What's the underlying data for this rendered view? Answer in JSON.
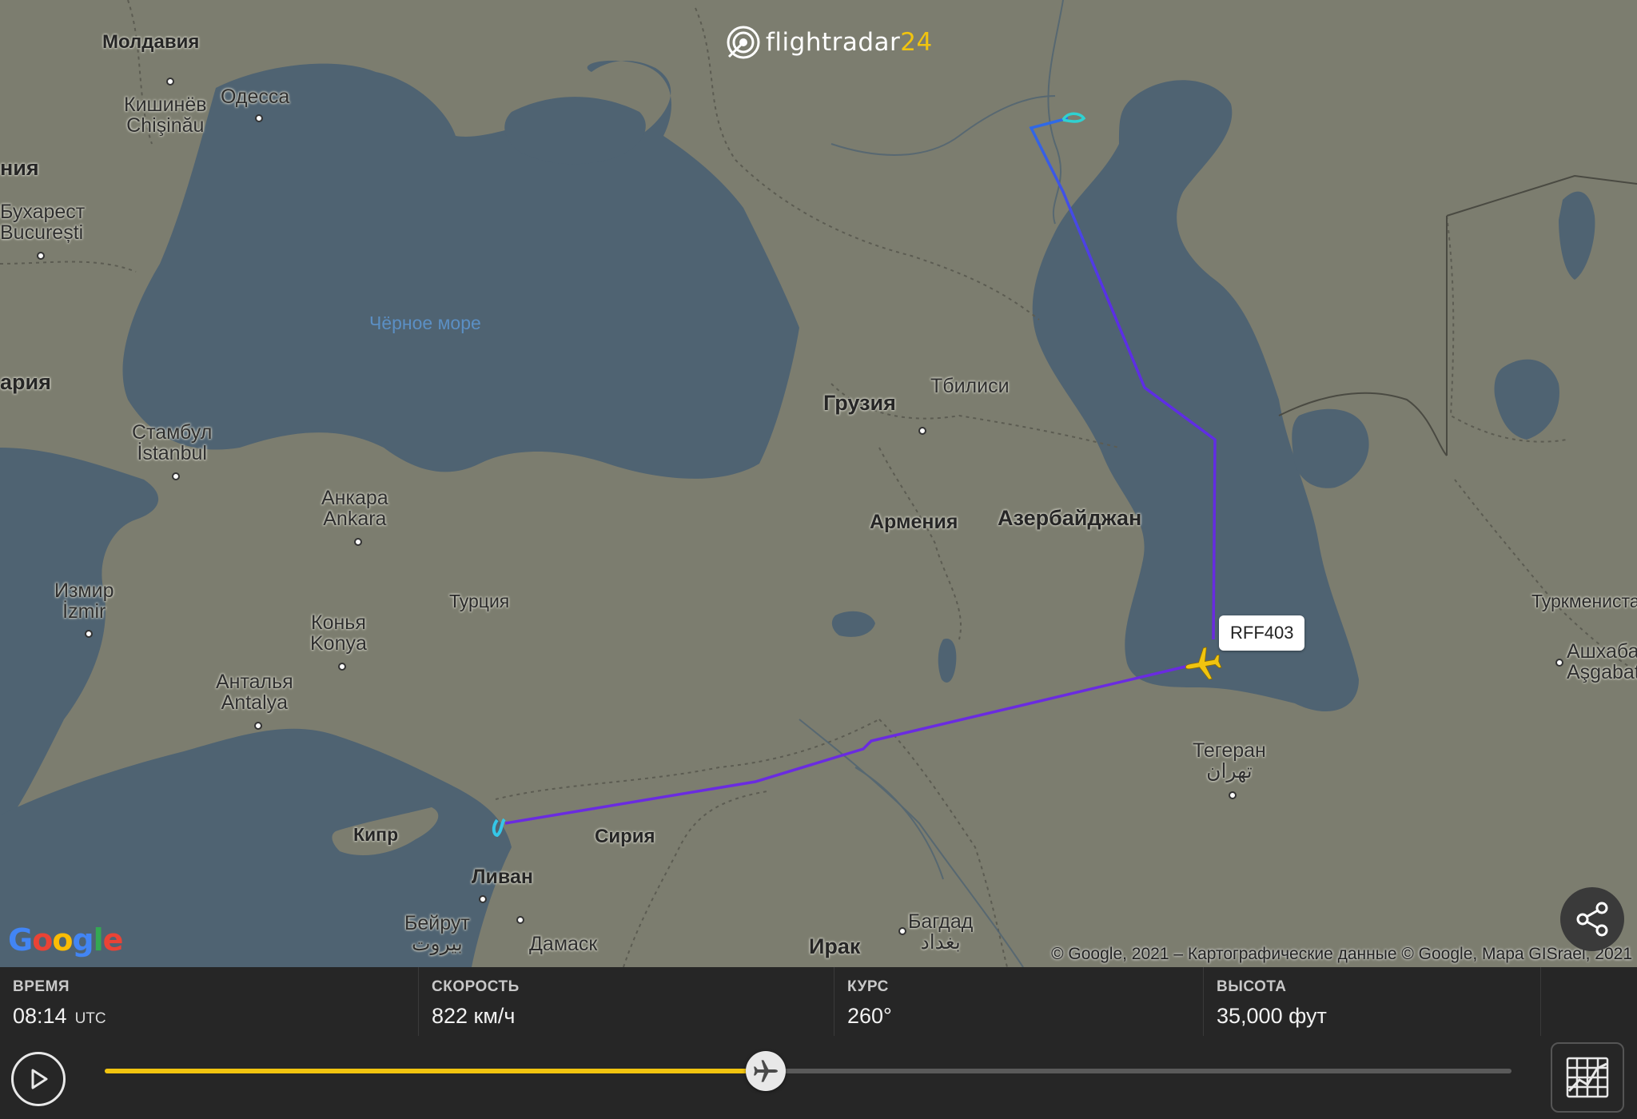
{
  "app": {
    "logo_name": "flightradar",
    "logo_number": "24"
  },
  "flight": {
    "callsign": "RFF403",
    "time_label": "ВРЕМЯ",
    "time_value": "08:14",
    "time_unit": "UTC",
    "speed_label": "СКОРОСТЬ",
    "speed_value": "822 км/ч",
    "heading_label": "КУРС",
    "heading_value": "260°",
    "altitude_label": "ВЫСОТА",
    "altitude_value": "35,000 фут",
    "playback_progress": 0.47
  },
  "map": {
    "attribution": "© Google, 2021 – Картографические данные © Google, Mapa GISrael, 2021",
    "google_logo": "Google",
    "sea_black": "Чёрное море",
    "countries": {
      "moldova": "Молдавия",
      "romania_partial": "ния",
      "bulgaria_partial": "ария",
      "georgia": "Грузия",
      "armenia": "Армения",
      "azerbaijan": "Азербайджан",
      "turkey": "Турция",
      "syria": "Сирия",
      "cyprus": "Кипр",
      "lebanon": "Ливан",
      "iraq": "Ирак",
      "turkmenistan": "Туркмениста"
    },
    "cities": {
      "chisinau_ru": "Кишинёв",
      "chisinau_local": "Chişinău",
      "odessa": "Одесса",
      "bucharest_ru": "Бухарест",
      "bucharest_local": "București",
      "istanbul_ru": "Стамбул",
      "istanbul_local": "İstanbul",
      "ankara_ru": "Анкара",
      "ankara_local": "Ankara",
      "izmir_ru": "Измир",
      "izmir_local": "İzmir",
      "konya_ru": "Конья",
      "konya_local": "Konya",
      "antalya_ru": "Анталья",
      "antalya_local": "Antalya",
      "tbilisi": "Тбилиси",
      "tehran_ru": "Тегеран",
      "tehran_local": "تهران",
      "beirut_ru": "Бейрут",
      "beirut_local": "بيروت",
      "damascus": "Дамаск",
      "baghdad_ru": "Багдад",
      "baghdad_local": "بغداد",
      "ashgabat_ru": "Ашхаба",
      "ashgabat_local": "Aşgabat"
    }
  }
}
